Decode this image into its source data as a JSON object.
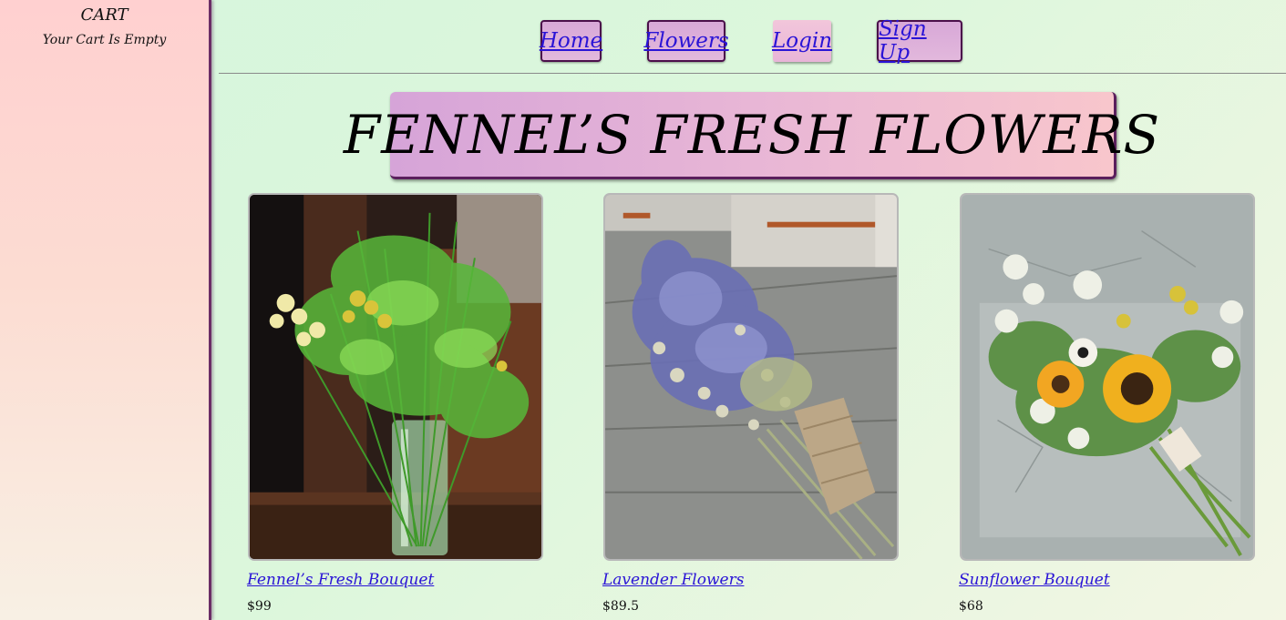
{
  "cart": {
    "title": "CART",
    "status": "Your Cart Is Empty"
  },
  "nav": {
    "home": "Home",
    "flowers": "Flowers",
    "login": "Login",
    "signup": "Sign Up"
  },
  "banner": {
    "title": "FENNEL’S FRESH FLOWERS"
  },
  "products": [
    {
      "name": "Fennel’s Fresh Bouquet",
      "price": "$99",
      "image": "fennel-bouquet-photo"
    },
    {
      "name": "Lavender Flowers",
      "price": "$89.5",
      "image": "lavender-bundle-photo"
    },
    {
      "name": "Sunflower Bouquet",
      "price": "$68",
      "image": "sunflower-bouquet-photo"
    }
  ],
  "colors": {
    "link": "#2a14d6",
    "nav_border": "#4b0f4b",
    "sidebar_border": "#6b2d66"
  }
}
